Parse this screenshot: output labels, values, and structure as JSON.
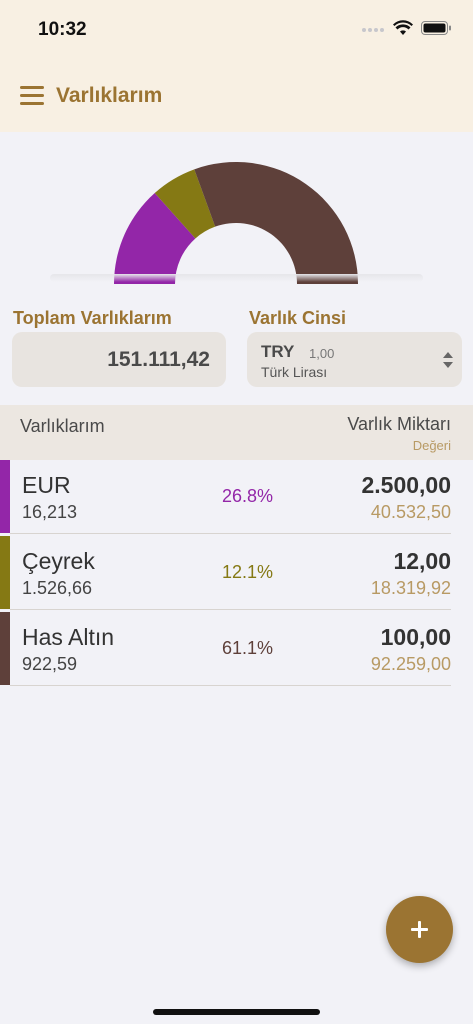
{
  "status": {
    "time": "10:32"
  },
  "nav": {
    "title": "Varlıklarım"
  },
  "summary": {
    "total_label": "Toplam Varlıklarım",
    "total_value": "151.111,42",
    "currency_label": "Varlık Cinsi",
    "currency_code": "TRY",
    "currency_rate": "1,00",
    "currency_name": "Türk Lirası"
  },
  "table": {
    "left_header": "Varlıklarım",
    "right_header": "Varlık Miktarı",
    "right_subheader": "Değeri"
  },
  "assets": [
    {
      "name": "EUR",
      "rate": "16,213",
      "percent": "26.8%",
      "amount": "2.500,00",
      "worth": "40.532,50",
      "color": "#9326a8"
    },
    {
      "name": "Çeyrek",
      "rate": "1.526,66",
      "percent": "12.1%",
      "amount": "12,00",
      "worth": "18.319,92",
      "color": "#857914"
    },
    {
      "name": "Has Altın",
      "rate": "922,59",
      "percent": "61.1%",
      "amount": "100,00",
      "worth": "92.259,00",
      "color": "#5e403a"
    }
  ],
  "colors": {
    "accent": "#9b7432",
    "header_bg": "#f8f0e3"
  },
  "icons": {
    "menu": "hamburger-icon",
    "add": "plus-icon",
    "stepper": "chevron-up-down-icon"
  }
}
